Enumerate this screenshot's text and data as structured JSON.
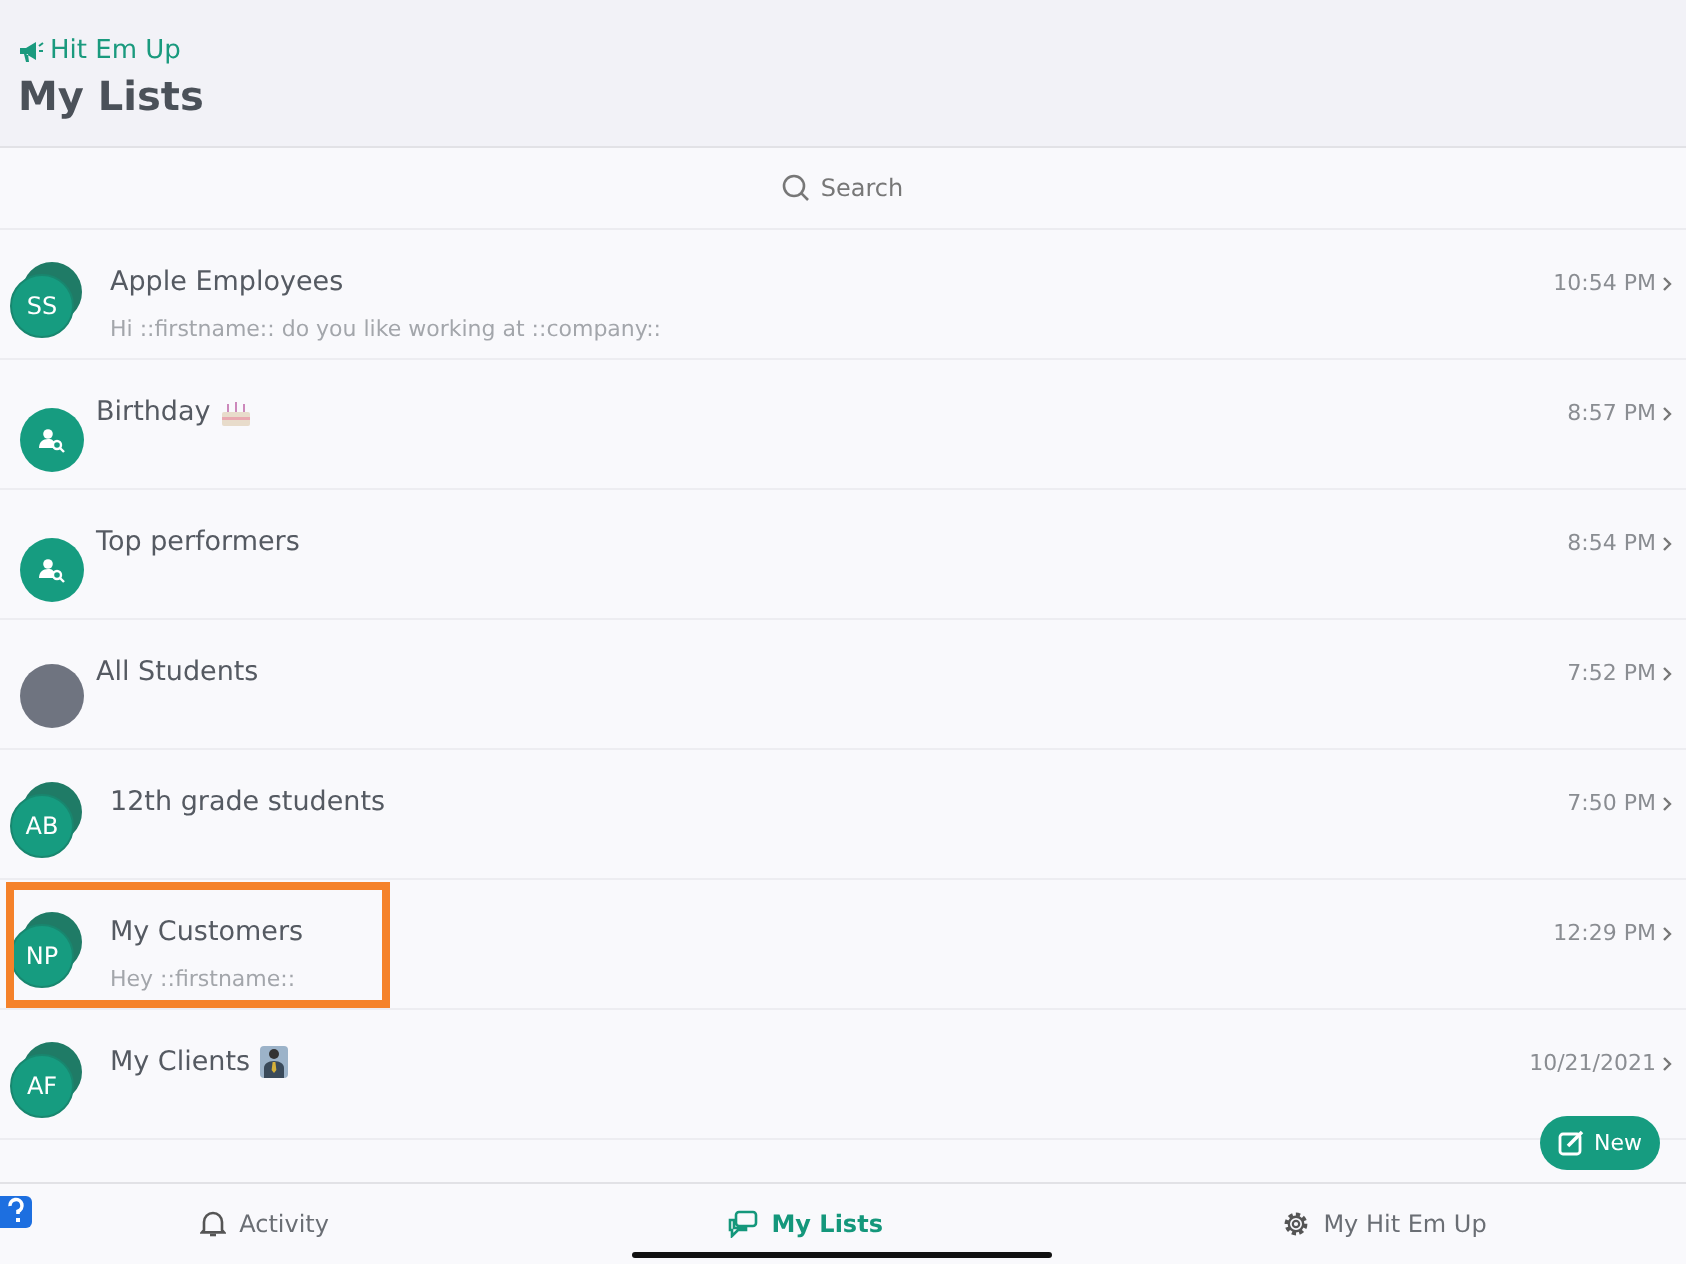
{
  "app_title": "Hit Em Up",
  "page_title": "My Lists",
  "search": {
    "placeholder": "Search"
  },
  "lists": [
    {
      "kind": "group",
      "initials": "SS",
      "name": "Apple Employees",
      "preview": "Hi ::firstname:: do you like working at ::company::",
      "time": "10:54 PM",
      "highlighted": false
    },
    {
      "kind": "smart",
      "name": "Birthday",
      "emoji": {
        "kind": "cake"
      },
      "time": "8:57 PM",
      "highlighted": false
    },
    {
      "kind": "smart",
      "name": "Top performers",
      "time": "8:54 PM",
      "highlighted": false
    },
    {
      "kind": "plain",
      "name": "All Students",
      "time": "7:52 PM",
      "highlighted": false
    },
    {
      "kind": "group",
      "initials": "AB",
      "name": "12th grade students",
      "time": "7:50 PM",
      "highlighted": false
    },
    {
      "kind": "group",
      "initials": "NP",
      "name": "My Customers",
      "preview": "Hey ::firstname::",
      "time": "12:29 PM",
      "highlighted": true
    },
    {
      "kind": "group",
      "initials": "AF",
      "name": "My Clients",
      "emoji": {
        "kind": "suit"
      },
      "time": "10/21/2021",
      "highlighted": false
    }
  ],
  "new_button": "New",
  "tabs": [
    {
      "label": "Activity",
      "selected": false
    },
    {
      "label": "My Lists",
      "selected": true
    },
    {
      "label": "My Hit Em Up",
      "selected": false
    }
  ]
}
